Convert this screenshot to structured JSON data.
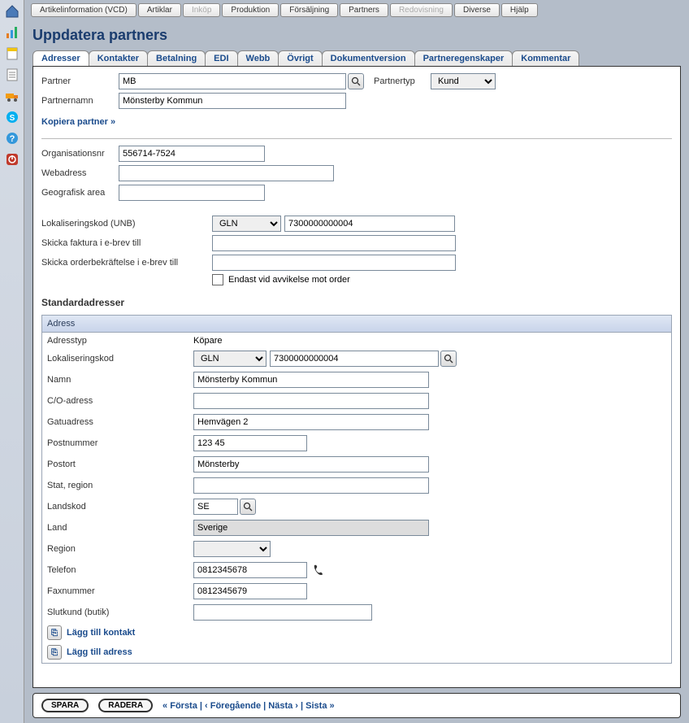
{
  "top_tabs": [
    "Artikelinformation (VCD)",
    "Artiklar",
    "Inköp",
    "Produktion",
    "Försäljning",
    "Partners",
    "Redovisning",
    "Diverse",
    "Hjälp"
  ],
  "top_tabs_disabled": [
    2,
    6
  ],
  "page_title": "Uppdatera partners",
  "sub_tabs": [
    "Adresser",
    "Kontakter",
    "Betalning",
    "EDI",
    "Webb",
    "Övrigt",
    "Dokumentversion",
    "Partneregenskaper",
    "Kommentar"
  ],
  "labels": {
    "partner": "Partner",
    "partnertyp": "Partnertyp",
    "partnernamn": "Partnernamn",
    "kopiera": "Kopiera partner »",
    "orgnr": "Organisationsnr",
    "webadress": "Webadress",
    "geoarea": "Geografisk area",
    "lokkod_unb": "Lokaliseringskod (UNB)",
    "skicka_faktura": "Skicka faktura i e-brev till",
    "skicka_order": "Skicka orderbekräftelse i e-brev till",
    "endast_avvik": "Endast vid avvikelse mot order",
    "standardadresser": "Standardadresser",
    "adress_header": "Adress",
    "adresstyp": "Adresstyp",
    "lokkod": "Lokaliseringskod",
    "namn": "Namn",
    "co": "C/O-adress",
    "gatu": "Gatuadress",
    "postnr": "Postnummer",
    "postort": "Postort",
    "stat": "Stat, region",
    "landskod": "Landskod",
    "land": "Land",
    "region": "Region",
    "telefon": "Telefon",
    "fax": "Faxnummer",
    "slutkund": "Slutkund (butik)",
    "add_kontakt": "Lägg till kontakt",
    "add_adress": "Lägg till adress",
    "spara": "SPARA",
    "radera": "RADERA",
    "nav": "« Första | ‹ Föregående | Nästa › | Sista »"
  },
  "values": {
    "partner": "MB",
    "partnertyp": "Kund",
    "partnernamn": "Mönsterby Kommun",
    "orgnr": "556714-7524",
    "webadress": "",
    "geoarea": "",
    "lokkod_unb_type": "GLN",
    "lokkod_unb_value": "7300000000004",
    "skicka_faktura": "",
    "skicka_order": "",
    "adresstyp": "Köpare",
    "adr_lokkod_type": "GLN",
    "adr_lokkod_value": "7300000000004",
    "namn": "Mönsterby Kommun",
    "co": "",
    "gatu": "Hemvägen 2",
    "postnr": "123 45",
    "postort": "Mönsterby",
    "stat": "",
    "landskod": "SE",
    "land": "Sverige",
    "region": "",
    "telefon": "0812345678",
    "fax": "0812345679",
    "slutkund": ""
  }
}
